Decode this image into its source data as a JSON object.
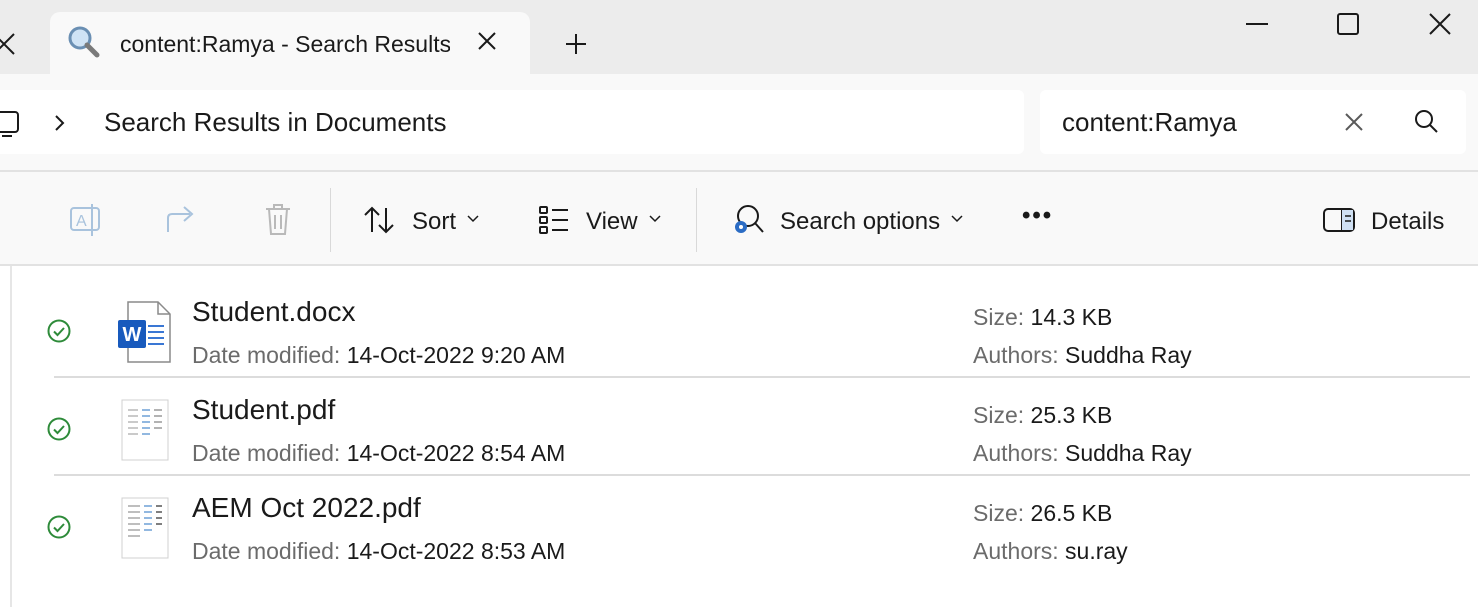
{
  "tab": {
    "title": "content:Ramya - Search Results in Documents",
    "icon": "search-icon"
  },
  "address": {
    "breadcrumb": "Search Results in Documents",
    "root_icon": "computer-icon"
  },
  "search": {
    "value": "content:Ramya"
  },
  "toolbar": {
    "sort_label": "Sort",
    "view_label": "View",
    "search_options_label": "Search options",
    "more_label": "•••",
    "details_label": "Details"
  },
  "results": [
    {
      "name": "Student.docx",
      "type": "word",
      "date_label": "Date modified:",
      "date": "14-Oct-2022 9:20 AM",
      "size_label": "Size:",
      "size": "14.3 KB",
      "authors_label": "Authors:",
      "authors": "Suddha Ray"
    },
    {
      "name": "Student.pdf",
      "type": "pdf",
      "date_label": "Date modified:",
      "date": "14-Oct-2022 8:54 AM",
      "size_label": "Size:",
      "size": "25.3 KB",
      "authors_label": "Authors:",
      "authors": "Suddha Ray"
    },
    {
      "name": "AEM Oct 2022.pdf",
      "type": "pdf",
      "date_label": "Date modified:",
      "date": "14-Oct-2022 8:53 AM",
      "size_label": "Size:",
      "size": "26.5 KB",
      "authors_label": "Authors:",
      "authors": "su.ray"
    }
  ],
  "colors": {
    "accent": "#0067c0",
    "status_ok": "#2e8b3a",
    "word_blue": "#185abd"
  }
}
